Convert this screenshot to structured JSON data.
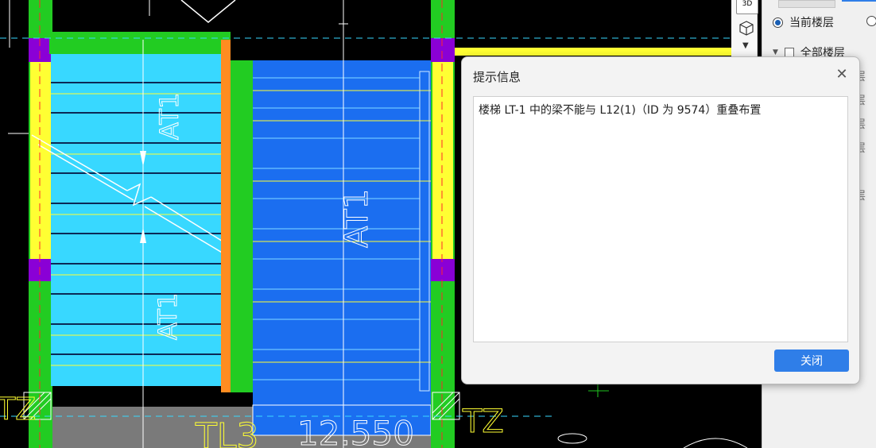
{
  "canvas": {
    "labels": {
      "at1_left_top": "AT1",
      "at1_left_bottom": "AT1",
      "at1_right": "AT1",
      "tz_left": "TZ",
      "tz_right": "TZ",
      "tl3": "TL3",
      "elevation": "12.550"
    }
  },
  "panel": {
    "btn_3d": "3D",
    "current_floor": "当前楼层",
    "all_floors": "全部楼层",
    "cut_labels": [
      "层",
      "层",
      "层",
      "层",
      "层"
    ]
  },
  "dialog": {
    "title": "提示信息",
    "message": "楼梯 LT-1 中的梁不能与 L12(1)（ID 为 9574）重叠布置",
    "close_label": "关闭"
  },
  "colors": {
    "green": "#22cc22",
    "yellow": "#ffff33",
    "cyan": "#38d8ff",
    "blue": "#1b6ef0",
    "orange": "#ff8c20",
    "purple": "#8a00d6",
    "primary_button": "#2f7ee8"
  }
}
